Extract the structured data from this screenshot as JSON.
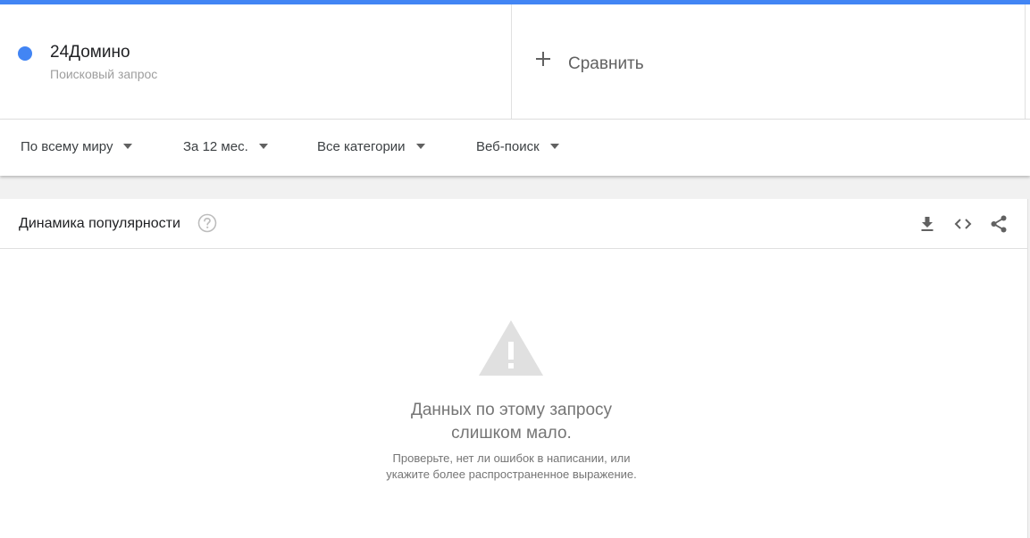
{
  "accent_color": "#4285f4",
  "term": {
    "name": "24Домино",
    "type": "Поисковый запрос"
  },
  "compare": {
    "label": "Сравнить",
    "icon": "plus-icon"
  },
  "filters": {
    "region": "По всему миру",
    "period": "За 12 мес.",
    "category": "Все категории",
    "search_type": "Веб-поиск"
  },
  "card": {
    "title": "Динамика популярности",
    "icons": [
      "help-icon",
      "download-icon",
      "embed-code-icon",
      "share-icon"
    ],
    "empty": {
      "icon": "warning-icon",
      "line1": "Данных по этому запросу",
      "line2": "слишком мало.",
      "hint1": "Проверьте, нет ли ошибок в написании, или",
      "hint2": "укажите более распространенное выражение."
    }
  }
}
